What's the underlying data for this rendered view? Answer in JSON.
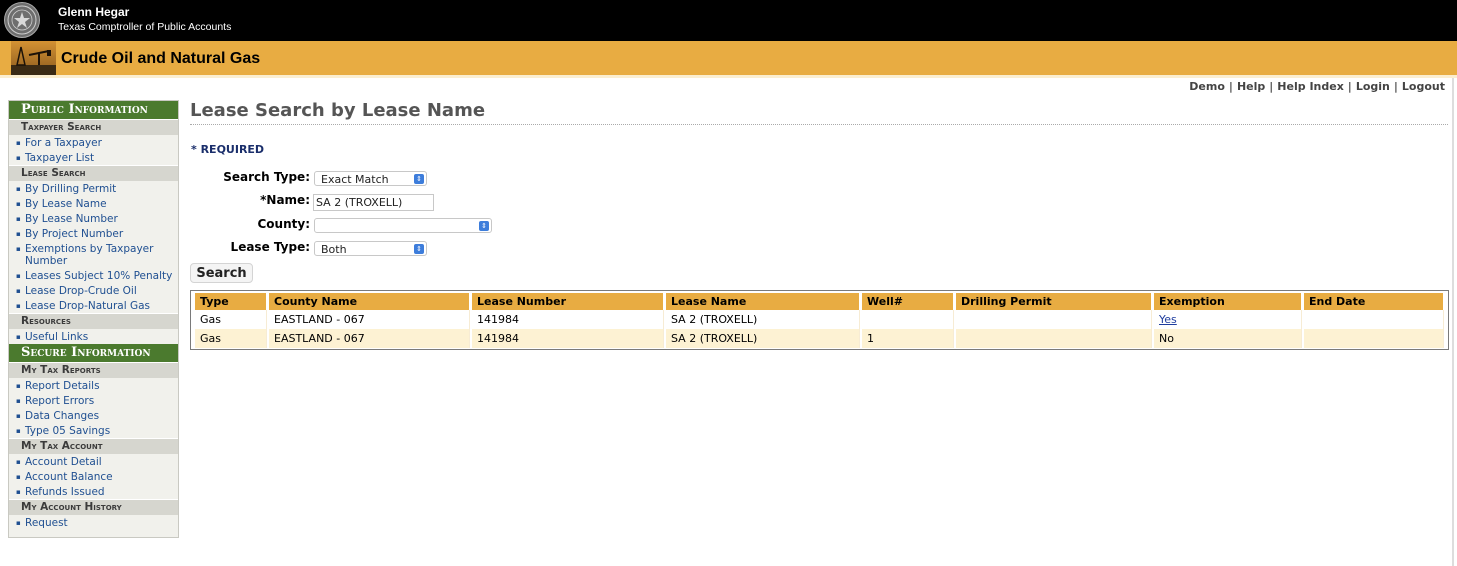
{
  "header": {
    "name": "Glenn Hegar",
    "subtitle": "Texas Comptroller of Public Accounts",
    "banner_title": "Crude Oil and Natural Gas",
    "seal_icon": "texas-seal-icon"
  },
  "top_links": [
    "Demo",
    "Help",
    "Help Index",
    "Login",
    "Logout"
  ],
  "sidebar": {
    "public_title": "Public Information",
    "taxpayer_search": {
      "title": "Taxpayer Search",
      "items": [
        "For a Taxpayer",
        "Taxpayer List"
      ]
    },
    "lease_search": {
      "title": "Lease Search",
      "items": [
        "By Drilling Permit",
        "By Lease Name",
        "By Lease Number",
        "By Project Number",
        "Exemptions by Taxpayer Number",
        "Leases Subject 10% Penalty",
        "Lease Drop-Crude Oil",
        "Lease Drop-Natural Gas"
      ]
    },
    "resources": {
      "title": "Resources",
      "items": [
        "Useful Links"
      ]
    },
    "secure_title": "Secure Information",
    "my_tax_reports": {
      "title": "My Tax Reports",
      "items": [
        "Report Details",
        "Report Errors",
        "Data Changes",
        "Type 05 Savings"
      ]
    },
    "my_tax_account": {
      "title": "My Tax Account",
      "items": [
        "Account Detail",
        "Account Balance",
        "Refunds Issued"
      ]
    },
    "my_account_history": {
      "title": "My Account History",
      "items": [
        "Request"
      ]
    }
  },
  "main": {
    "title": "Lease Search by Lease Name",
    "required_note": "* REQUIRED",
    "form": {
      "search_type_label": "Search Type:",
      "search_type_value": "Exact Match",
      "name_label": "*Name:",
      "name_value": "SA 2 (TROXELL)",
      "county_label": "County:",
      "county_value": "",
      "lease_type_label": "Lease Type:",
      "lease_type_value": "Both"
    },
    "search_button": "Search",
    "results": {
      "columns": [
        "Type",
        "County Name",
        "Lease Number",
        "Lease Name",
        "Well#",
        "Drilling Permit",
        "Exemption",
        "End Date"
      ],
      "rows": [
        [
          "Gas",
          "EASTLAND - 067",
          "141984",
          "SA 2 (TROXELL)",
          "",
          "",
          "Yes",
          ""
        ],
        [
          "Gas",
          "EASTLAND - 067",
          "141984",
          "SA 2 (TROXELL)",
          "1",
          "",
          "No",
          ""
        ]
      ]
    }
  },
  "colors": {
    "header_bg": "#000000",
    "banner": "#e8ac42",
    "sidebar_main": "#4b7a2e",
    "link": "#1f4f91",
    "row_alt": "#fdf2d3"
  }
}
